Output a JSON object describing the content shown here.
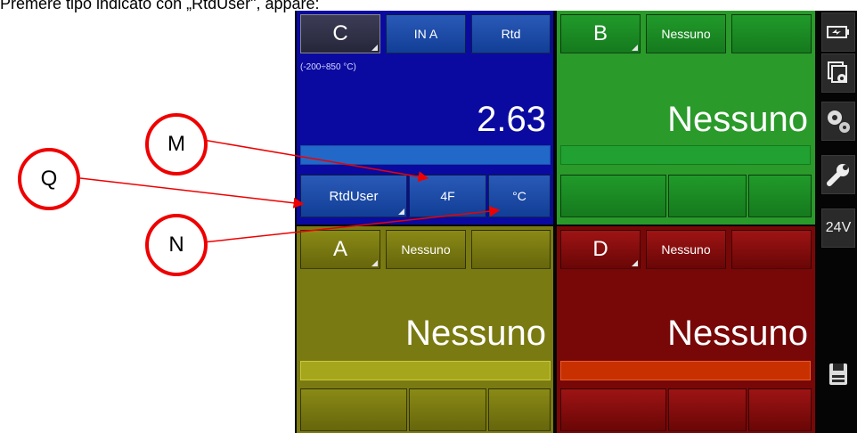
{
  "caption": "Premere tipo indicato con „RtdUser\", appare:",
  "panels": {
    "c": {
      "letter": "C",
      "mode": "IN A",
      "type": "Rtd",
      "range": "(-200÷850 °C)",
      "value": "2.63",
      "sub": [
        "RtdUser",
        "4F",
        "°C"
      ]
    },
    "b": {
      "letter": "B",
      "type": "Nessuno",
      "value": "Nessuno"
    },
    "a": {
      "letter": "A",
      "type": "Nessuno",
      "value": "Nessuno"
    },
    "d": {
      "letter": "D",
      "type": "Nessuno",
      "value": "Nessuno"
    }
  },
  "sidebar": {
    "icons": [
      "charging-icon",
      "window-settings-icon",
      "gears-icon",
      "wrench-icon",
      "save-icon"
    ],
    "voltage": "24V"
  },
  "markers": [
    "M",
    "Q",
    "N"
  ],
  "colors": {
    "panel_c": "#0a0aa0",
    "panel_b": "#2a9a2a",
    "panel_a": "#7a7a12",
    "panel_d": "#780808",
    "marker": "#e00000"
  }
}
